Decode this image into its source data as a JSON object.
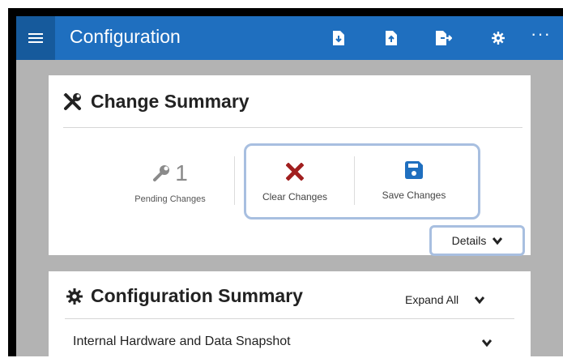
{
  "app": {
    "title": "Configuration"
  },
  "toolbar": {
    "icons": [
      "file-import-icon",
      "file-export-icon",
      "sign-out-icon",
      "gear-icon"
    ],
    "more_label": "···"
  },
  "change_summary": {
    "title": "Change Summary",
    "pending_count": "1",
    "pending_label": "Pending Changes",
    "clear_label": "Clear Changes",
    "save_label": "Save Changes",
    "details_label": "Details"
  },
  "configuration_summary": {
    "title": "Configuration Summary",
    "expand_all_label": "Expand All",
    "rows": [
      {
        "label": "Internal Hardware and Data Snapshot"
      }
    ]
  },
  "colors": {
    "topbar": "#1f6fbf",
    "clear_icon": "#a11f1f",
    "save_icon": "#1f6fbf",
    "highlight_border": "#a8bfe0"
  }
}
